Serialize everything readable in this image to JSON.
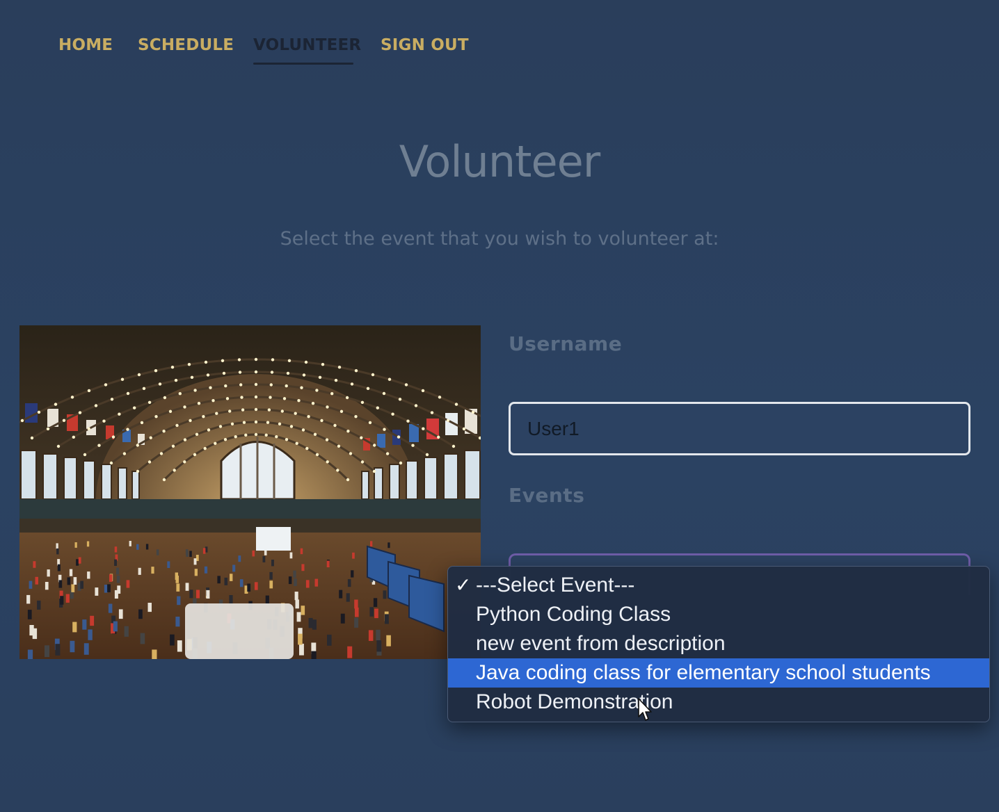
{
  "nav": {
    "items": [
      {
        "label": "HOME",
        "active": false
      },
      {
        "label": "SCHEDULE",
        "active": false
      },
      {
        "label": "VOLUNTEER",
        "active": true
      },
      {
        "label": "SIGN OUT",
        "active": false
      }
    ]
  },
  "page": {
    "title": "Volunteer",
    "subtitle": "Select the event that you wish to volunteer at:"
  },
  "form": {
    "username_label": "Username",
    "username_value": "User1",
    "events_label": "Events"
  },
  "dropdown": {
    "check_glyph": "✓",
    "options": [
      {
        "label": "---Select Event---",
        "selected": true,
        "highlighted": false
      },
      {
        "label": "Python Coding Class",
        "selected": false,
        "highlighted": false
      },
      {
        "label": "new event from description",
        "selected": false,
        "highlighted": false
      },
      {
        "label": "Java coding class for elementary school students",
        "selected": false,
        "highlighted": true
      },
      {
        "label": "Robot Demonstration",
        "selected": false,
        "highlighted": false
      }
    ]
  },
  "colors": {
    "background": "#2b4262",
    "nav_link": "#c9ad62",
    "nav_active": "#1b2434",
    "highlight": "#2d67d3"
  }
}
